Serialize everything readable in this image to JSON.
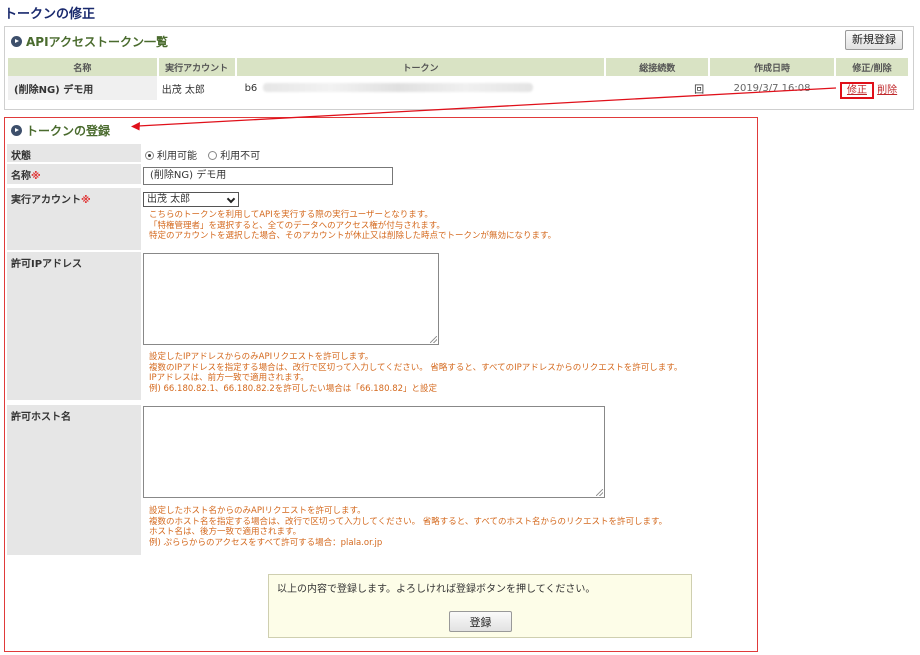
{
  "page_title": "トークンの修正",
  "list": {
    "title": "APIアクセストークン一覧",
    "new_button": "新規登録",
    "columns": [
      "名称",
      "実行アカウント",
      "トークン",
      "総接続数",
      "作成日時",
      "修正/削除"
    ],
    "row": {
      "name": "(削除NG) デモ用",
      "account": "出茂 太郎",
      "token_prefix": "b6",
      "count_suffix": "回",
      "created": "2019/3/7 16:08",
      "edit": "修正",
      "delete": "削除"
    }
  },
  "form": {
    "title": "トークンの登録",
    "status_label": "状態",
    "status_options": [
      "利用可能",
      "利用不可"
    ],
    "status_selected": "利用可能",
    "name_label": "名称",
    "required_mark": "※",
    "name_value": "(削除NG) デモ用",
    "account_label": "実行アカウント",
    "account_value": "出茂 太郎",
    "account_notes": [
      "こちらのトークンを利用してAPIを実行する際の実行ユーザーとなります。",
      "「特権管理者」を選択すると、全てのデータへのアクセス権が付与されます。",
      "特定のアカウントを選択した場合、そのアカウントが休止又は削除した時点でトークンが無効になります。"
    ],
    "ip_label": "許可IPアドレス",
    "ip_notes": [
      "設定したIPアドレスからのみAPIリクエストを許可します。",
      "複数のIPアドレスを指定する場合は、改行で区切って入力してください。 省略すると、すべてのIPアドレスからのリクエストを許可します。",
      "IPアドレスは、前方一致で適用されます。",
      "例) 66.180.82.1、66.180.82.2を許可したい場合は「66.180.82」と設定"
    ],
    "host_label": "許可ホスト名",
    "host_notes": [
      "設定したホスト名からのみAPIリクエストを許可します。",
      "複数のホスト名を指定する場合は、改行で区切って入力してください。 省略すると、すべてのホスト名からのリクエストを許可します。",
      "ホスト名は、後方一致で適用されます。",
      "例) ぷららからのアクセスをすべて許可する場合：plala.or.jp"
    ],
    "confirm_text": "以上の内容で登録します。よろしければ登録ボタンを押してください。",
    "submit_button": "登録"
  },
  "colors": {
    "highlight_red": "#e0101a",
    "header_green": "#d9e3c4",
    "note_orange": "#d4691e"
  }
}
